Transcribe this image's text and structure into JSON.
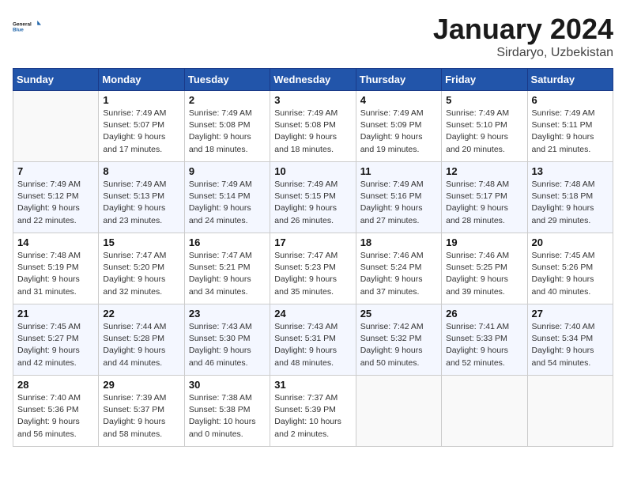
{
  "logo": {
    "line1": "General",
    "line2": "Blue"
  },
  "title": "January 2024",
  "subtitle": "Sirdaryo, Uzbekistan",
  "days_of_week": [
    "Sunday",
    "Monday",
    "Tuesday",
    "Wednesday",
    "Thursday",
    "Friday",
    "Saturday"
  ],
  "weeks": [
    [
      {
        "day": null
      },
      {
        "day": "1",
        "sunrise": "Sunrise: 7:49 AM",
        "sunset": "Sunset: 5:07 PM",
        "daylight": "Daylight: 9 hours and 17 minutes."
      },
      {
        "day": "2",
        "sunrise": "Sunrise: 7:49 AM",
        "sunset": "Sunset: 5:08 PM",
        "daylight": "Daylight: 9 hours and 18 minutes."
      },
      {
        "day": "3",
        "sunrise": "Sunrise: 7:49 AM",
        "sunset": "Sunset: 5:08 PM",
        "daylight": "Daylight: 9 hours and 18 minutes."
      },
      {
        "day": "4",
        "sunrise": "Sunrise: 7:49 AM",
        "sunset": "Sunset: 5:09 PM",
        "daylight": "Daylight: 9 hours and 19 minutes."
      },
      {
        "day": "5",
        "sunrise": "Sunrise: 7:49 AM",
        "sunset": "Sunset: 5:10 PM",
        "daylight": "Daylight: 9 hours and 20 minutes."
      },
      {
        "day": "6",
        "sunrise": "Sunrise: 7:49 AM",
        "sunset": "Sunset: 5:11 PM",
        "daylight": "Daylight: 9 hours and 21 minutes."
      }
    ],
    [
      {
        "day": "7",
        "sunrise": "Sunrise: 7:49 AM",
        "sunset": "Sunset: 5:12 PM",
        "daylight": "Daylight: 9 hours and 22 minutes."
      },
      {
        "day": "8",
        "sunrise": "Sunrise: 7:49 AM",
        "sunset": "Sunset: 5:13 PM",
        "daylight": "Daylight: 9 hours and 23 minutes."
      },
      {
        "day": "9",
        "sunrise": "Sunrise: 7:49 AM",
        "sunset": "Sunset: 5:14 PM",
        "daylight": "Daylight: 9 hours and 24 minutes."
      },
      {
        "day": "10",
        "sunrise": "Sunrise: 7:49 AM",
        "sunset": "Sunset: 5:15 PM",
        "daylight": "Daylight: 9 hours and 26 minutes."
      },
      {
        "day": "11",
        "sunrise": "Sunrise: 7:49 AM",
        "sunset": "Sunset: 5:16 PM",
        "daylight": "Daylight: 9 hours and 27 minutes."
      },
      {
        "day": "12",
        "sunrise": "Sunrise: 7:48 AM",
        "sunset": "Sunset: 5:17 PM",
        "daylight": "Daylight: 9 hours and 28 minutes."
      },
      {
        "day": "13",
        "sunrise": "Sunrise: 7:48 AM",
        "sunset": "Sunset: 5:18 PM",
        "daylight": "Daylight: 9 hours and 29 minutes."
      }
    ],
    [
      {
        "day": "14",
        "sunrise": "Sunrise: 7:48 AM",
        "sunset": "Sunset: 5:19 PM",
        "daylight": "Daylight: 9 hours and 31 minutes."
      },
      {
        "day": "15",
        "sunrise": "Sunrise: 7:47 AM",
        "sunset": "Sunset: 5:20 PM",
        "daylight": "Daylight: 9 hours and 32 minutes."
      },
      {
        "day": "16",
        "sunrise": "Sunrise: 7:47 AM",
        "sunset": "Sunset: 5:21 PM",
        "daylight": "Daylight: 9 hours and 34 minutes."
      },
      {
        "day": "17",
        "sunrise": "Sunrise: 7:47 AM",
        "sunset": "Sunset: 5:23 PM",
        "daylight": "Daylight: 9 hours and 35 minutes."
      },
      {
        "day": "18",
        "sunrise": "Sunrise: 7:46 AM",
        "sunset": "Sunset: 5:24 PM",
        "daylight": "Daylight: 9 hours and 37 minutes."
      },
      {
        "day": "19",
        "sunrise": "Sunrise: 7:46 AM",
        "sunset": "Sunset: 5:25 PM",
        "daylight": "Daylight: 9 hours and 39 minutes."
      },
      {
        "day": "20",
        "sunrise": "Sunrise: 7:45 AM",
        "sunset": "Sunset: 5:26 PM",
        "daylight": "Daylight: 9 hours and 40 minutes."
      }
    ],
    [
      {
        "day": "21",
        "sunrise": "Sunrise: 7:45 AM",
        "sunset": "Sunset: 5:27 PM",
        "daylight": "Daylight: 9 hours and 42 minutes."
      },
      {
        "day": "22",
        "sunrise": "Sunrise: 7:44 AM",
        "sunset": "Sunset: 5:28 PM",
        "daylight": "Daylight: 9 hours and 44 minutes."
      },
      {
        "day": "23",
        "sunrise": "Sunrise: 7:43 AM",
        "sunset": "Sunset: 5:30 PM",
        "daylight": "Daylight: 9 hours and 46 minutes."
      },
      {
        "day": "24",
        "sunrise": "Sunrise: 7:43 AM",
        "sunset": "Sunset: 5:31 PM",
        "daylight": "Daylight: 9 hours and 48 minutes."
      },
      {
        "day": "25",
        "sunrise": "Sunrise: 7:42 AM",
        "sunset": "Sunset: 5:32 PM",
        "daylight": "Daylight: 9 hours and 50 minutes."
      },
      {
        "day": "26",
        "sunrise": "Sunrise: 7:41 AM",
        "sunset": "Sunset: 5:33 PM",
        "daylight": "Daylight: 9 hours and 52 minutes."
      },
      {
        "day": "27",
        "sunrise": "Sunrise: 7:40 AM",
        "sunset": "Sunset: 5:34 PM",
        "daylight": "Daylight: 9 hours and 54 minutes."
      }
    ],
    [
      {
        "day": "28",
        "sunrise": "Sunrise: 7:40 AM",
        "sunset": "Sunset: 5:36 PM",
        "daylight": "Daylight: 9 hours and 56 minutes."
      },
      {
        "day": "29",
        "sunrise": "Sunrise: 7:39 AM",
        "sunset": "Sunset: 5:37 PM",
        "daylight": "Daylight: 9 hours and 58 minutes."
      },
      {
        "day": "30",
        "sunrise": "Sunrise: 7:38 AM",
        "sunset": "Sunset: 5:38 PM",
        "daylight": "Daylight: 10 hours and 0 minutes."
      },
      {
        "day": "31",
        "sunrise": "Sunrise: 7:37 AM",
        "sunset": "Sunset: 5:39 PM",
        "daylight": "Daylight: 10 hours and 2 minutes."
      },
      {
        "day": null
      },
      {
        "day": null
      },
      {
        "day": null
      }
    ]
  ]
}
